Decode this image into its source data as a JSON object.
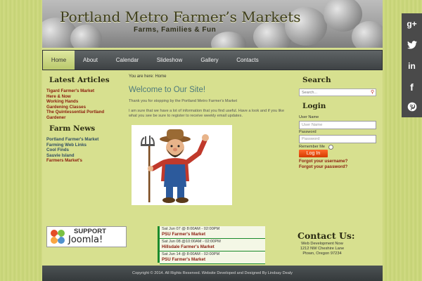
{
  "header": {
    "title": "Portland Metro Farmer’s Markets",
    "tagline": "Farms, Families & Fun"
  },
  "nav": {
    "items": [
      {
        "label": "Home",
        "active": true
      },
      {
        "label": "About"
      },
      {
        "label": "Calendar"
      },
      {
        "label": "Slideshow"
      },
      {
        "label": "Gallery"
      },
      {
        "label": "Contacts"
      }
    ]
  },
  "left": {
    "latest_title": "Latest Articles",
    "latest_items": [
      "Tigard Farmer's Market",
      "Here & Now",
      "Working Hands",
      "Gardening Classes",
      "The Quintessential Portland",
      "Gardener"
    ],
    "farm_title": "Farm News",
    "farm_items": [
      "Portland Farmer's Market",
      "Farming Web Links",
      "Cool Finds",
      "Sauvie Island",
      "Farmers Market's"
    ]
  },
  "main": {
    "breadcrumb": "You are here:  Home",
    "title": "Welcome to Our Site!",
    "para1": "Thank you for stopping by the Portland Metro Farmer's Market",
    "para2": "I am sure that we have a lot of information that you find useful. Have a look and if you like what you see be sure to register to receive weekly email updates."
  },
  "right": {
    "search_title": "Search",
    "search_placeholder": "Search...",
    "login_title": "Login",
    "username_label": "User Name",
    "username_placeholder": "User Name",
    "password_label": "Password",
    "password_placeholder": "Password",
    "remember_label": "Remember Me",
    "login_button": "Log In",
    "forgot_username": "Forgot your username?",
    "forgot_password": "Forgot your password?"
  },
  "joomla": {
    "support": "SUPPORT",
    "name": "Joomla!"
  },
  "events": [
    {
      "date": "Sat Jun 07 @ 8:00AM - 02:00PM",
      "name": "PSU Farmer's Market"
    },
    {
      "date": "Sat Jun 08 @10:00AM - 02:00PM",
      "name": "Hillsdale Farmer's Market"
    },
    {
      "date": "Sat Jun 14 @ 8:00AM - 02:00PM",
      "name": "PSU Farmer's Market"
    }
  ],
  "contact": {
    "title": "Contact Us:",
    "line1": "Web Development Now",
    "line2": "1212 NW Cheshire Lane",
    "line3": "Ptown, Oregon 97234"
  },
  "footer": {
    "text": "Copyright © 2014. All Rights Reserved. Website Developed and Designed By Lindsay Dealy"
  },
  "social": {
    "icons": [
      "google-plus-icon",
      "twitter-icon",
      "linkedin-icon",
      "facebook-icon",
      "pinterest-icon"
    ]
  }
}
